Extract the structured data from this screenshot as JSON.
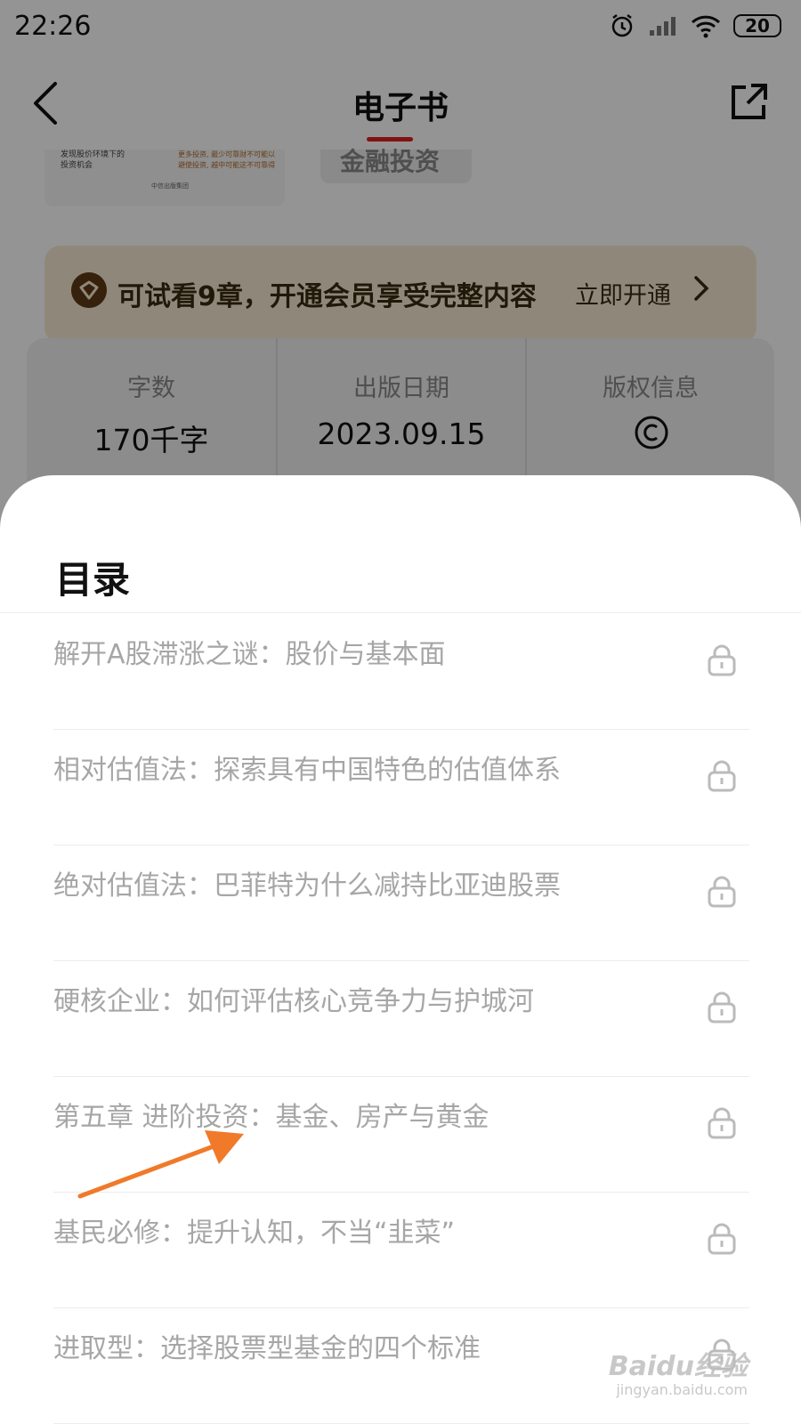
{
  "status_bar": {
    "time": "22:26",
    "battery": "20"
  },
  "nav": {
    "title": "电子书"
  },
  "book_preview": {
    "cover_text": "发现股价环境下的\n投资机会",
    "cover_text2": "更多投资, 最少可靠财不可能以\n避使投资, 越中可能这不可靠得",
    "cover_footer": "中信出版集团",
    "tag": "金融投资"
  },
  "vip_banner": {
    "text": "可试看9章，开通会员享受完整内容",
    "link": "立即开通"
  },
  "info": {
    "words_label": "字数",
    "words_value": "170千字",
    "date_label": "出版日期",
    "date_value": "2023.09.15",
    "copyright_label": "版权信息"
  },
  "toc": {
    "title": "目录",
    "items": [
      {
        "label": "解开A股滞涨之谜：股价与基本面",
        "locked": true
      },
      {
        "label": "相对估值法：探索具有中国特色的估值体系",
        "locked": true
      },
      {
        "label": "绝对估值法：巴菲特为什么减持比亚迪股票",
        "locked": true
      },
      {
        "label": "硬核企业：如何评估核心竞争力与护城河",
        "locked": true
      },
      {
        "label": "第五章 进阶投资：基金、房产与黄金",
        "locked": true
      },
      {
        "label": "基民必修：提升认知，不当“韭菜”",
        "locked": true
      },
      {
        "label": "进取型：选择股票型基金的四个标准",
        "locked": true
      }
    ]
  },
  "watermark": {
    "main": "Baidu经验",
    "sub": "jingyan.baidu.com"
  },
  "colors": {
    "accent": "#e02020",
    "arrow": "#f07a2a",
    "vip_bg": "#f6ead3",
    "vip_text": "#3a2a10"
  }
}
